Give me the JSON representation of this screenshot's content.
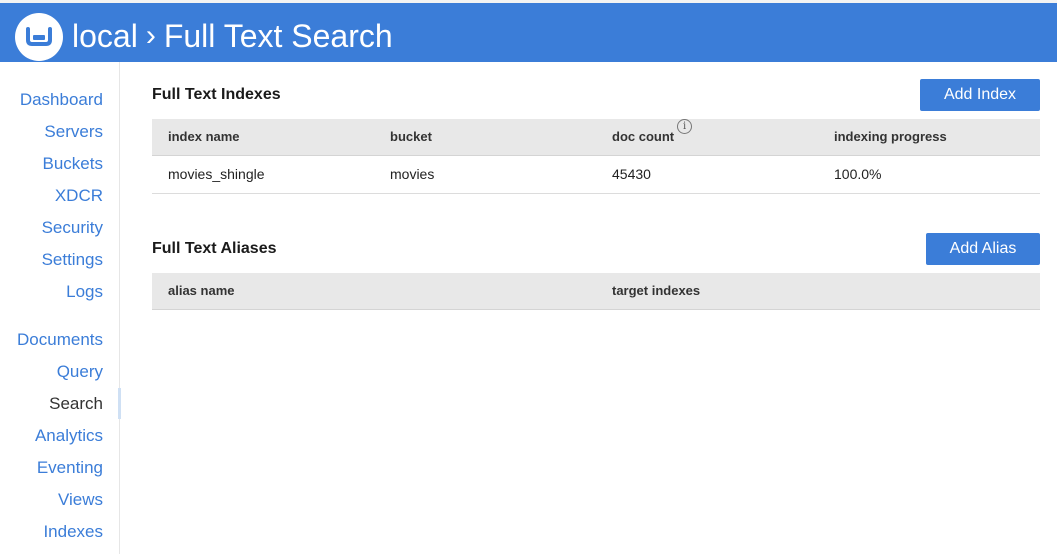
{
  "header": {
    "cluster_label": "local",
    "separator": "›",
    "page_title": "Full Text Search"
  },
  "sidebar": {
    "items": [
      {
        "label": "Dashboard"
      },
      {
        "label": "Servers"
      },
      {
        "label": "Buckets"
      },
      {
        "label": "XDCR"
      },
      {
        "label": "Security"
      },
      {
        "label": "Settings"
      },
      {
        "label": "Logs"
      },
      {
        "label": "Documents"
      },
      {
        "label": "Query"
      },
      {
        "label": "Search"
      },
      {
        "label": "Analytics"
      },
      {
        "label": "Eventing"
      },
      {
        "label": "Views"
      },
      {
        "label": "Indexes"
      }
    ],
    "active": "Search"
  },
  "indexes": {
    "title": "Full Text Indexes",
    "add_label": "Add Index",
    "columns": [
      "index name",
      "bucket",
      "doc count",
      "indexing progress"
    ],
    "rows": [
      {
        "name": "movies_shingle",
        "bucket": "movies",
        "doc_count": "45430",
        "progress": "100.0%"
      }
    ]
  },
  "aliases": {
    "title": "Full Text Aliases",
    "add_label": "Add Alias",
    "columns": [
      "alias name",
      "target indexes"
    ],
    "rows": []
  },
  "colors": {
    "brand": "#3b7dd8",
    "table_header_bg": "#e8e8e8"
  }
}
